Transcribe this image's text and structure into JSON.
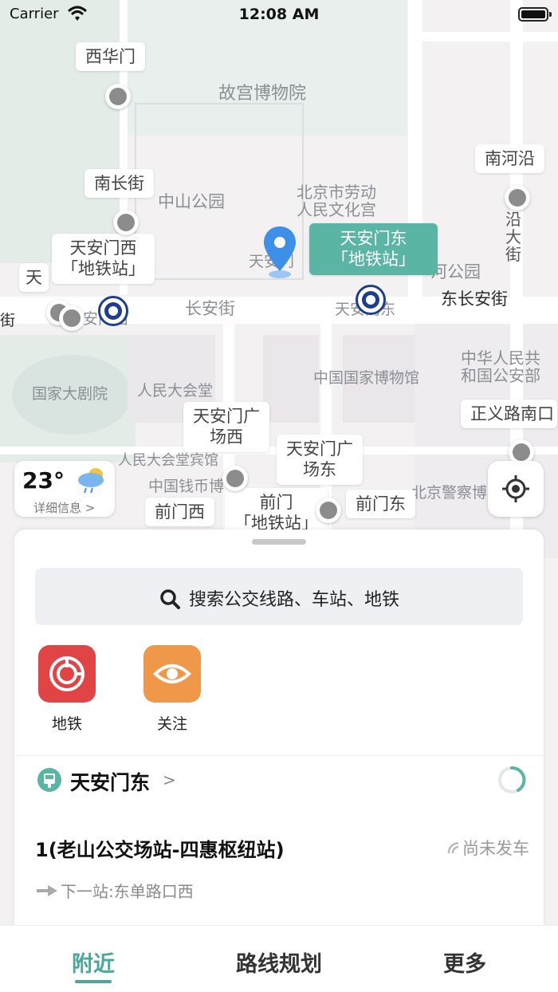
{
  "status_bar": {
    "carrier": "Carrier",
    "time": "12:08 AM"
  },
  "map": {
    "labels": {
      "gugong": "故宫博物院",
      "zhongshan": "中山公园",
      "laodong": "北京市劳动\n人民文化宫",
      "tiananmen": "天安门",
      "changan": "长安街",
      "dongchangan": "东长安街",
      "heyuan": "河公园",
      "gonganbu": "中华人民共\n和国公安部",
      "bowuguan": "中国国家博物馆",
      "juyuan": "国家大剧院",
      "huitang": "人民大会堂",
      "binguan": "人民大会堂宾馆",
      "qianbi": "中国钱币博",
      "jingcha": "北京警察博",
      "nanhe_street": "沿\n大\n街",
      "jie_left": "街",
      "tian_left": "天",
      "menxi": "安门西",
      "mendong": "天安门东"
    },
    "callouts": {
      "xihuamen": "西华门",
      "nanchangjie": "南长街",
      "tiananmen_xi_subway": "天安门西\n「地铁站」",
      "tiananmen_dong_subway": "天安门东\n「地铁站」",
      "nanheyan": "南河沿",
      "zhengyilu": "正义路南口",
      "guangchang_xi": "天安门广\n场西",
      "guangchang_dong": "天安门广\n场东",
      "qianmen_xi": "前门西",
      "qianmen_subway": "前门\n「地铁站」",
      "qianmen_dong": "前门东"
    },
    "weather": {
      "temp": "23°",
      "detail": "详细信息 >"
    }
  },
  "sheet": {
    "search_placeholder": "搜索公交线路、车站、地铁",
    "shortcuts": [
      {
        "label": "地铁",
        "color": "#e04444"
      },
      {
        "label": "关注",
        "color": "#f0984a"
      }
    ],
    "station": {
      "name": "天安门东",
      "chevron": ">"
    },
    "route": {
      "title": "1(老山公交场站-四惠枢纽站)",
      "status": "尚未发车",
      "next_stop": "下一站:东单路口西"
    }
  },
  "tabs": [
    {
      "label": "附近",
      "active": true
    },
    {
      "label": "路线规划",
      "active": false
    },
    {
      "label": "更多",
      "active": false
    }
  ],
  "colors": {
    "accent": "#4aa89a",
    "selected_callout": "#5bb5a5",
    "subway_blue": "#1d3d8f"
  }
}
